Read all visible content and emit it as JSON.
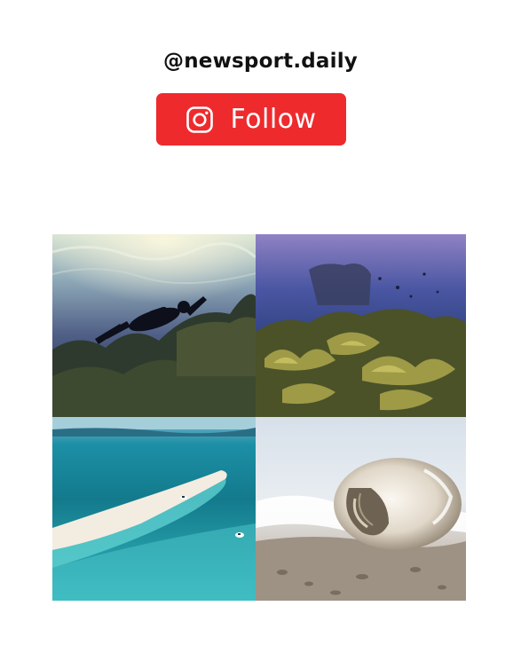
{
  "profile": {
    "handle": "@newsport.daily"
  },
  "follow_button": {
    "label": "Follow",
    "icon": "instagram-icon",
    "color": "#ee2a2d"
  },
  "gallery": {
    "tiles": [
      {
        "scene": "scuba-diver-over-reef"
      },
      {
        "scene": "coral-reef"
      },
      {
        "scene": "turquoise-lagoon-sandbar"
      },
      {
        "scene": "seashell-on-beach"
      }
    ]
  }
}
